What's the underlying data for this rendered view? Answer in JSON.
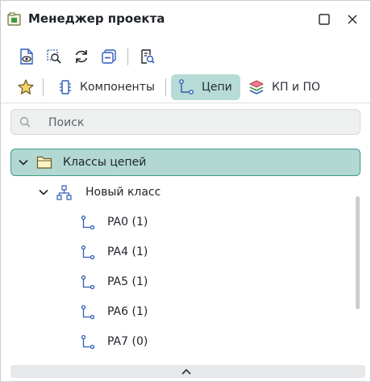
{
  "window": {
    "title": "Менеджер проекта",
    "icons": {
      "app": "project-manager-icon",
      "maximize": "maximize-icon",
      "close": "close-icon"
    }
  },
  "toolbar": {
    "icons": [
      "document-view-icon",
      "zoom-area-icon",
      "refresh-icon",
      "collapse-all-icon",
      "inspect-icon"
    ]
  },
  "tabs": {
    "favorites_icon": "star-icon",
    "items": [
      {
        "label": "Компоненты",
        "icon": "component-icon",
        "active": false
      },
      {
        "label": "Цепи",
        "icon": "net-icon",
        "active": true
      },
      {
        "label": "КП и ПО",
        "icon": "layers-icon",
        "active": false
      }
    ]
  },
  "search": {
    "placeholder": "Поиск",
    "value": ""
  },
  "tree": {
    "root": {
      "label": "Классы цепей",
      "expanded": true,
      "selected": true
    },
    "class": {
      "label": "Новый класс",
      "expanded": true
    },
    "nets": [
      {
        "label": "PA0 (1)"
      },
      {
        "label": "PA4 (1)"
      },
      {
        "label": "PA5 (1)"
      },
      {
        "label": "PA6 (1)"
      },
      {
        "label": "PA7 (0)"
      }
    ]
  },
  "colors": {
    "accent": "#b7dbd6",
    "selection_border": "#3f9a8e",
    "icon_blue": "#2f5bb7"
  }
}
